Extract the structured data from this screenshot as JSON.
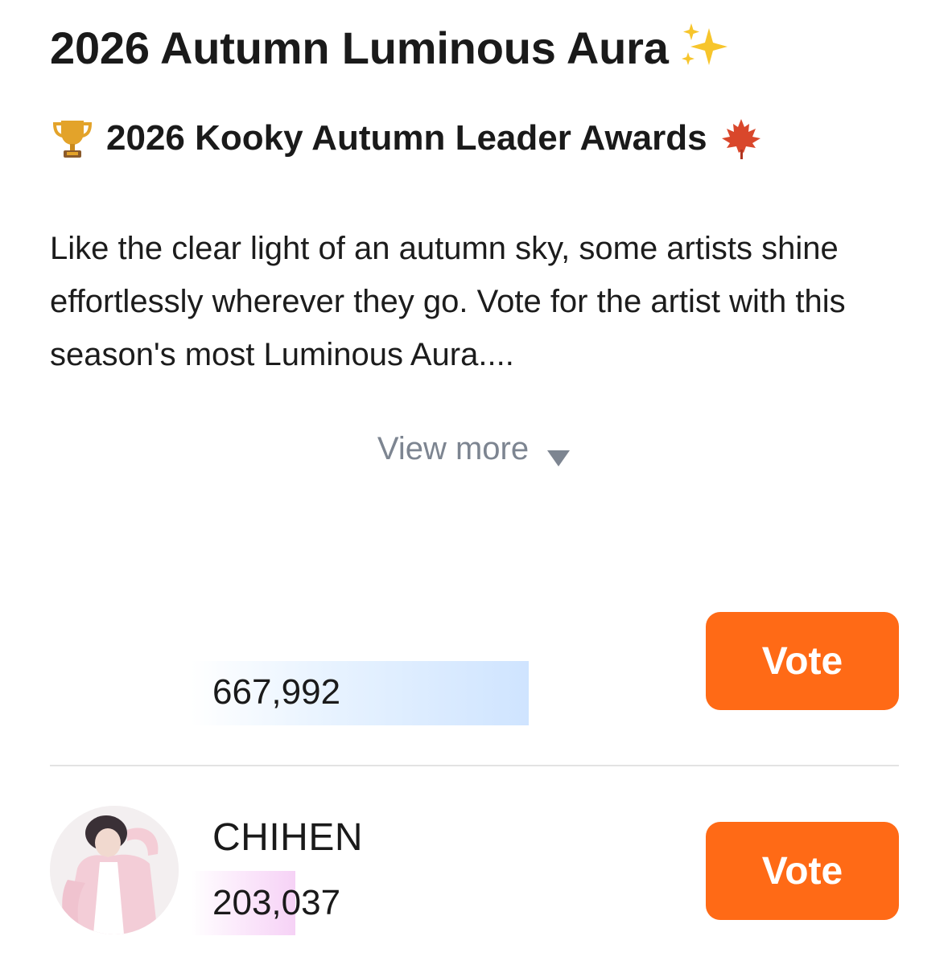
{
  "header": {
    "title": "2026 Autumn Luminous Aura",
    "title_icon": "sparkles-icon",
    "subtitle": "2026 Kooky Autumn Leader Awards",
    "subtitle_leading_icon": "trophy-icon",
    "subtitle_trailing_icon": "maple-leaf-icon"
  },
  "description": {
    "text": "Like the clear light of an autumn sky, some artists shine effortlessly wherever they go. Vote for the artist with this season's most Luminous Aura...."
  },
  "view_more": {
    "label": "View more",
    "icon": "triangle-down-icon"
  },
  "candidates": [
    {
      "name": "",
      "votes": "667,992",
      "vote_label": "Vote",
      "bar_fraction": 1.0
    },
    {
      "name": "CHIHEN",
      "votes": "203,037",
      "vote_label": "Vote",
      "bar_fraction": 0.3
    }
  ],
  "colors": {
    "vote_button": "#ff6a16",
    "view_more_text": "#7d8591",
    "bar_blue": "#cfe4ff",
    "bar_pink": "#f6d2f6"
  }
}
